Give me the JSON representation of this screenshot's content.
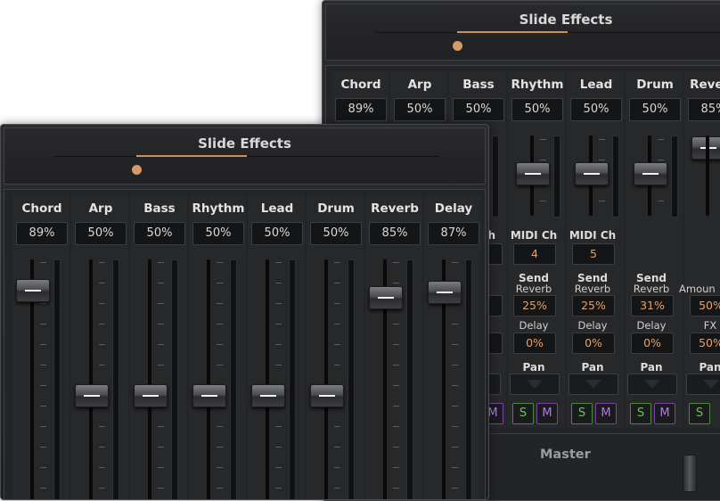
{
  "back_window": {
    "title": "Slide Effects",
    "channels": [
      {
        "name": "Chord",
        "value": "89%"
      },
      {
        "name": "Arp",
        "value": "50%"
      },
      {
        "name": "Bass",
        "value": "50%"
      },
      {
        "name": "Rhythm",
        "value": "50%"
      },
      {
        "name": "Lead",
        "value": "50%"
      },
      {
        "name": "Drum",
        "value": "50%"
      },
      {
        "name": "Reverb",
        "value": "85%"
      }
    ],
    "midi_label": "MIDI Ch",
    "midi_values": [
      "4",
      "5"
    ],
    "send_label": "Send",
    "reverb_label": "Reverb",
    "delay_label": "Delay",
    "send_reverb_values": [
      "25%",
      "25%",
      "31%"
    ],
    "send_delay_values": [
      "0%",
      "0%",
      "0%"
    ],
    "amount_label": "Amoun",
    "amount_value": "50%",
    "fx_label": "FX",
    "fx_value": "50%",
    "pan_label": "Pan",
    "solo_label": "S",
    "mute_label": "M",
    "master_label": "Master",
    "partial_left_label": "h"
  },
  "front_window": {
    "title": "Slide Effects",
    "channels": [
      {
        "name": "Chord",
        "value": "89%",
        "level": 0.89
      },
      {
        "name": "Arp",
        "value": "50%",
        "level": 0.5
      },
      {
        "name": "Bass",
        "value": "50%",
        "level": 0.5
      },
      {
        "name": "Rhythm",
        "value": "50%",
        "level": 0.5
      },
      {
        "name": "Lead",
        "value": "50%",
        "level": 0.5
      },
      {
        "name": "Drum",
        "value": "50%",
        "level": 0.5
      },
      {
        "name": "Reverb",
        "value": "85%",
        "level": 0.85
      },
      {
        "name": "Delay",
        "value": "87%",
        "level": 0.87
      }
    ]
  },
  "colors": {
    "accent": "#d08f5a",
    "solo": "#6cc35a",
    "mute": "#b57ae0",
    "orange_text": "#e8a267"
  }
}
